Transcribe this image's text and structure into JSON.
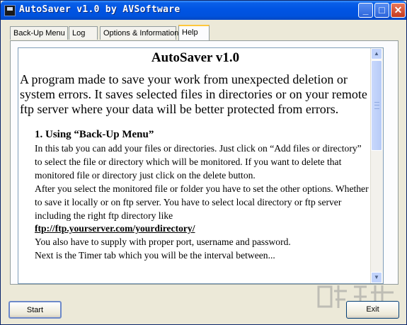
{
  "window": {
    "title": "AutoSaver v1.0 by AVSoftware",
    "controls": [
      "minimize",
      "maximize",
      "close"
    ]
  },
  "tabs": [
    {
      "label": "Back-Up Menu",
      "active": false
    },
    {
      "label": "Log",
      "active": false
    },
    {
      "label": "Options & Information",
      "active": false
    },
    {
      "label": "Help",
      "active": true
    }
  ],
  "help": {
    "title": "AutoSaver v1.0",
    "intro": "A program made to save your work from unexpected deletion or system errors. It saves selected files in directories or on your remote ftp server where your data will be better protected from errors.",
    "section_heading": "1.  Using “Back-Up Menu”",
    "lines": [
      "In this tab you can add your files or directories. Just click on “Add files or directory” to select the file or directory which will be monitored. If you want to delete that monitored file or directory just click on the delete button.",
      "After you select the monitored file or folder you have to set the other options. Whether to save it locally or on ftp server. You have to select local directory or ftp server including the right ftp directory like"
    ],
    "ftp_example": "ftp://ftp.yourserver.com/yourdirectory/",
    "line_after": "You also have to supply with proper port, username and password.",
    "line_cut": "Next is the Timer tab which you will be the interval between..."
  },
  "buttons": {
    "start": "Start",
    "exit": "Exit"
  }
}
